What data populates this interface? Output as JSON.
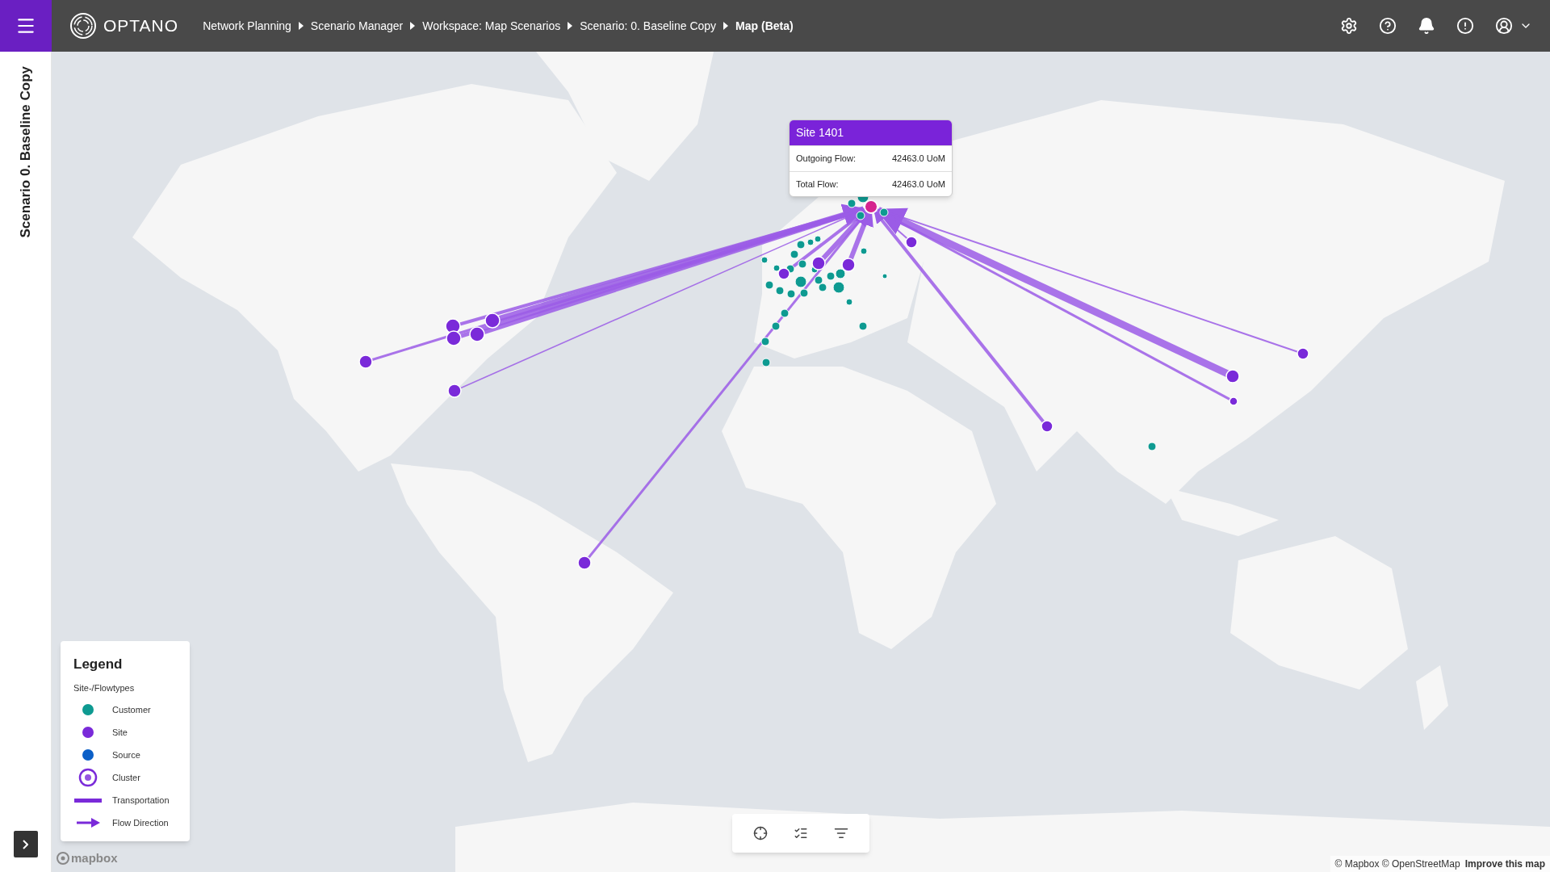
{
  "header": {
    "logo_text": "OPTANO",
    "breadcrumbs": [
      {
        "label": "Network Planning",
        "current": false
      },
      {
        "label": "Scenario Manager",
        "current": false
      },
      {
        "label": "Workspace: Map Scenarios",
        "current": false
      },
      {
        "label": "Scenario: 0. Baseline Copy",
        "current": false
      },
      {
        "label": "Map (Beta)",
        "current": true
      }
    ]
  },
  "sidebar": {
    "title": "Scenario 0. Baseline Copy"
  },
  "tooltip": {
    "title": "Site 1401",
    "rows": [
      {
        "label": "Outgoing Flow:",
        "value": "42463.0 UoM"
      },
      {
        "label": "Total Flow:",
        "value": "42463.0 UoM"
      }
    ]
  },
  "legend": {
    "title": "Legend",
    "subtitle": "Site-/Flowtypes",
    "items": [
      {
        "kind": "dot",
        "label": "Customer",
        "color": "#0e9a91"
      },
      {
        "kind": "dot",
        "label": "Site",
        "color": "#7a2ad9"
      },
      {
        "kind": "dot",
        "label": "Source",
        "color": "#0b5fc7"
      },
      {
        "kind": "cluster",
        "label": "Cluster",
        "color": "#7a2ad9"
      },
      {
        "kind": "line",
        "label": "Transportation",
        "color": "#7a2ad9"
      },
      {
        "kind": "arrow",
        "label": "Flow Direction",
        "color": "#7a2ad9"
      }
    ]
  },
  "map": {
    "logo_text": "mapbox",
    "attribution": "© Mapbox © OpenStreetMap",
    "improve_link": "Improve this map"
  }
}
